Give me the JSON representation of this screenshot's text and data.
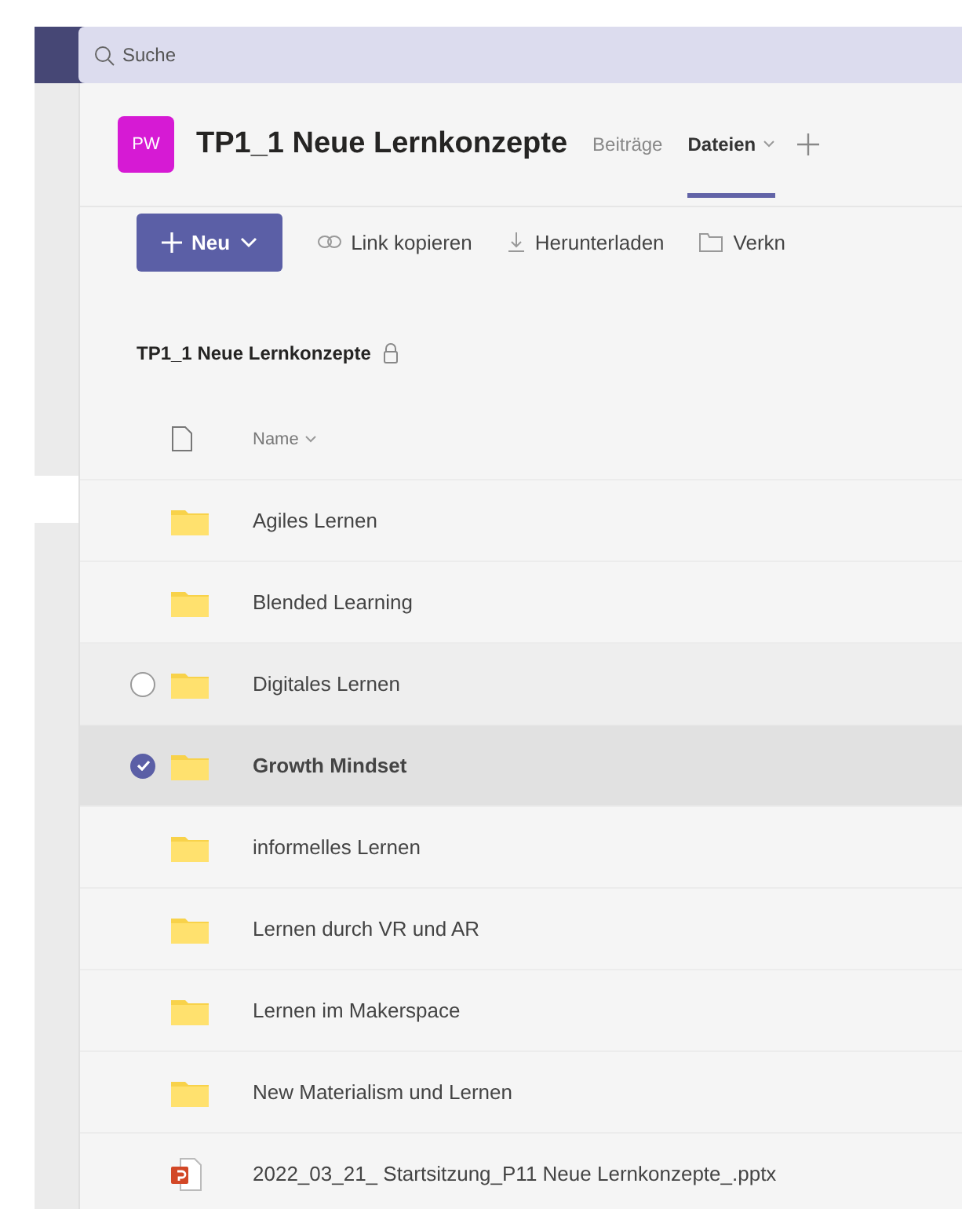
{
  "search": {
    "placeholder": "Suche"
  },
  "team": {
    "avatar": "PW",
    "name": "TP1_1 Neue Lernkonzepte"
  },
  "tabs": [
    {
      "label": "Beiträge",
      "selected": false,
      "dropdown": false
    },
    {
      "label": "Dateien",
      "selected": true,
      "dropdown": true
    }
  ],
  "toolbar": {
    "new_button": "Neu",
    "actions": [
      {
        "kind": "link",
        "label": "Link kopieren"
      },
      {
        "kind": "download",
        "label": "Herunterladen"
      },
      {
        "kind": "shortcut",
        "label": "Verkn"
      }
    ]
  },
  "breadcrumb": {
    "label": "TP1_1 Neue Lernkonzepte",
    "locked": true
  },
  "table": {
    "column": "Name",
    "rows": [
      {
        "kind": "folder",
        "name": "Agiles Lernen",
        "selected": false,
        "hovered": false
      },
      {
        "kind": "folder",
        "name": "Blended Learning",
        "selected": false,
        "hovered": false
      },
      {
        "kind": "folder",
        "name": "Digitales Lernen",
        "selected": false,
        "hovered": true
      },
      {
        "kind": "folder",
        "name": "Growth Mindset",
        "selected": true,
        "hovered": false
      },
      {
        "kind": "folder",
        "name": "informelles Lernen",
        "selected": false,
        "hovered": false
      },
      {
        "kind": "folder",
        "name": "Lernen durch VR und AR",
        "selected": false,
        "hovered": false
      },
      {
        "kind": "folder",
        "name": "Lernen im Makerspace",
        "selected": false,
        "hovered": false
      },
      {
        "kind": "folder",
        "name": "New Materialism und Lernen",
        "selected": false,
        "hovered": false
      },
      {
        "kind": "pptx",
        "name": "2022_03_21_ Startsitzung_P11 Neue Lernkonzepte_.pptx",
        "selected": false,
        "hovered": false
      }
    ]
  }
}
